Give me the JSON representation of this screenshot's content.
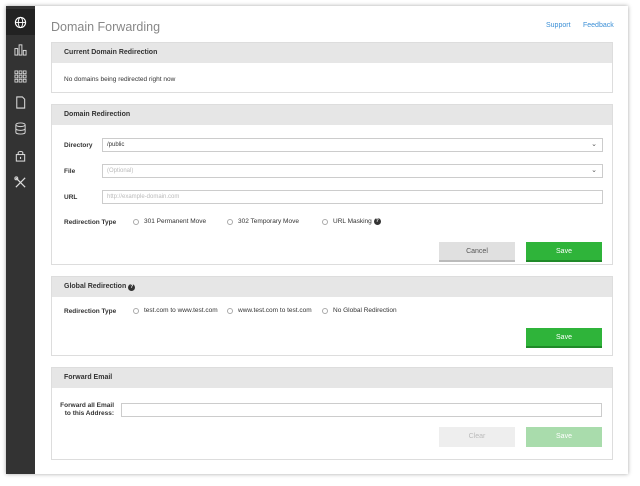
{
  "sidebar": {
    "items": [
      {
        "icon": "globe-icon",
        "active": true
      },
      {
        "icon": "bar-chart-icon"
      },
      {
        "icon": "grid-icon"
      },
      {
        "icon": "document-icon"
      },
      {
        "icon": "database-icon"
      },
      {
        "icon": "lock-icon"
      },
      {
        "icon": "tools-icon"
      }
    ]
  },
  "header": {
    "title": "Domain Forwarding",
    "support_label": "Support",
    "feedback_label": "Feedback"
  },
  "current_redirection": {
    "title": "Current Domain Redirection",
    "empty_message": "No domains being redirected right now"
  },
  "domain_redirection": {
    "title": "Domain Redirection",
    "directory_label": "Directory",
    "directory_value": "/public",
    "file_label": "File",
    "file_placeholder": "(Optional)",
    "url_label": "URL",
    "url_placeholder": "http://example-domain.com",
    "type_label": "Redirection Type",
    "options": [
      "301 Permanent Move",
      "302 Temporary Move",
      "URL Masking"
    ],
    "cancel_label": "Cancel",
    "save_label": "Save"
  },
  "global_redirection": {
    "title": "Global Redirection",
    "type_label": "Redirection Type",
    "options": [
      "test.com to www.test.com",
      "www.test.com to test.com",
      "No Global Redirection"
    ],
    "save_label": "Save"
  },
  "forward_email": {
    "title": "Forward Email",
    "label_line1": "Forward all Email",
    "label_line2": "to this Address:",
    "clear_label": "Clear",
    "save_label": "Save"
  },
  "colors": {
    "accent_green": "#2fb43a",
    "link_blue": "#3b8fd6",
    "sidebar": "#333333"
  }
}
